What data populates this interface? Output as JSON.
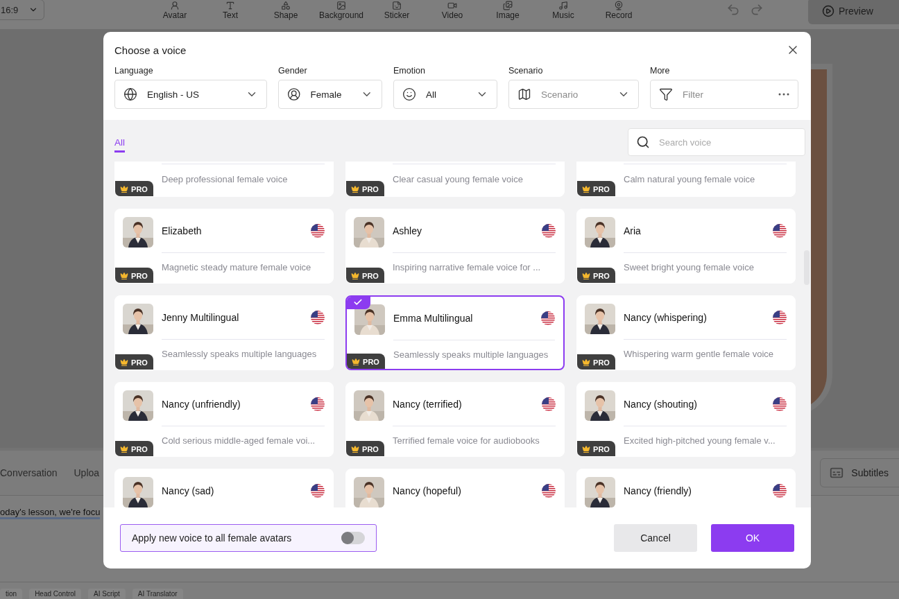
{
  "background": {
    "ratio": "16:9",
    "tools": [
      "Avatar",
      "Text",
      "Shape",
      "Background",
      "Sticker",
      "Video",
      "Image",
      "Music",
      "Record"
    ],
    "preview": "Preview",
    "script_tabs": [
      "Conversation",
      "Uploa"
    ],
    "subtitles": "Subtitles",
    "script_text": "oday's lesson, we're focu",
    "chips": [
      "tion",
      "Head Control",
      "AI Script",
      "AI Translator"
    ]
  },
  "dialog": {
    "title": "Choose a voice",
    "filters": [
      {
        "label": "Language",
        "kind": "globe",
        "value": "English - US"
      },
      {
        "label": "Gender",
        "kind": "person",
        "value": "Female"
      },
      {
        "label": "Emotion",
        "kind": "smile",
        "value": "All"
      },
      {
        "label": "Scenario",
        "kind": "map",
        "placeholder": "Scenario"
      },
      {
        "label": "More",
        "kind": "filter",
        "placeholder": "Filter"
      }
    ],
    "tabs": [
      {
        "label": "All",
        "selected": true
      }
    ],
    "search": {
      "placeholder": "Search voice"
    },
    "voices": [
      {
        "description": "Deep professional female voice",
        "badge": "PRO",
        "selected": false
      },
      {
        "description": "Clear casual young female voice",
        "badge": "PRO",
        "selected": false
      },
      {
        "description": "Calm natural young female voice",
        "badge": "PRO",
        "selected": false
      },
      {
        "name": "Elizabeth",
        "description": "Magnetic steady mature female voice",
        "badge": "PRO",
        "selected": false
      },
      {
        "name": "Ashley",
        "description": "Inspiring narrative female voice for ...",
        "badge": "PRO",
        "selected": false
      },
      {
        "name": "Aria",
        "description": "Sweet bright young female voice",
        "badge": "PRO",
        "selected": false
      },
      {
        "name": "Jenny Multilingual",
        "description": "Seamlessly speaks multiple languages",
        "badge": "PRO",
        "selected": false
      },
      {
        "name": "Emma Multilingual",
        "description": "Seamlessly speaks multiple languages",
        "badge": "PRO",
        "selected": true
      },
      {
        "name": "Nancy (whispering)",
        "description": "Whispering warm gentle female voice",
        "badge": "PRO",
        "selected": false
      },
      {
        "name": "Nancy (unfriendly)",
        "description": "Cold serious middle-aged female voi...",
        "badge": "PRO",
        "selected": false
      },
      {
        "name": "Nancy (terrified)",
        "description": "Terrified female voice for audiobooks",
        "badge": "PRO",
        "selected": false
      },
      {
        "name": "Nancy (shouting)",
        "description": "Excited high-pitched young female v...",
        "badge": "PRO",
        "selected": false
      },
      {
        "name": "Nancy (sad)",
        "selected": false
      },
      {
        "name": "Nancy (hopeful)",
        "selected": false
      },
      {
        "name": "Nancy (friendly)",
        "selected": false
      }
    ],
    "apply_all": {
      "label": "Apply new voice to all female avatars",
      "on": false
    },
    "buttons": {
      "cancel": "Cancel",
      "ok": "OK"
    }
  }
}
